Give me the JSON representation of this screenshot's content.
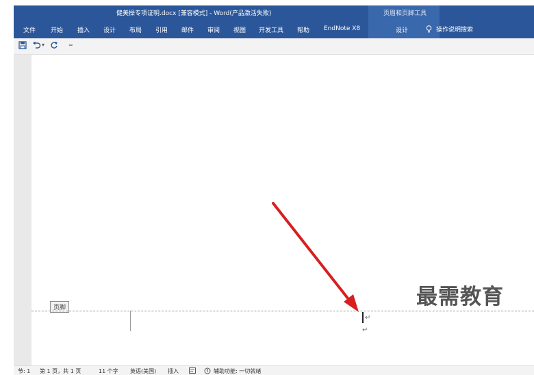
{
  "window": {
    "title": "健美操专项证明.docx [兼容模式] - Word(产品激活失败)",
    "context_group": "页眉和页脚工具"
  },
  "ribbon": {
    "tabs": [
      "文件",
      "开始",
      "插入",
      "设计",
      "布局",
      "引用",
      "邮件",
      "审阅",
      "视图",
      "开发工具",
      "帮助",
      "EndNote X8"
    ],
    "context_tab": "设计",
    "tell_me": "操作说明搜索"
  },
  "qat": {
    "icons": [
      "save-icon",
      "undo-icon",
      "redo-icon",
      "customize-icon"
    ],
    "undo_dropdown": "▾",
    "customize_glyph": "="
  },
  "document": {
    "footer_label": "页脚",
    "paragraph_mark": "↵"
  },
  "watermark": "最需教育",
  "statusbar": {
    "section": "节: 1",
    "page": "第 1 页，共 1 页",
    "words": "11 个字",
    "language": "英语(美国)",
    "mode": "插入",
    "accessibility": "辅助功能: 一切就绪"
  },
  "colors": {
    "ribbon": "#2b579a",
    "context": "#3a68ad",
    "arrow": "#d71f1f"
  }
}
